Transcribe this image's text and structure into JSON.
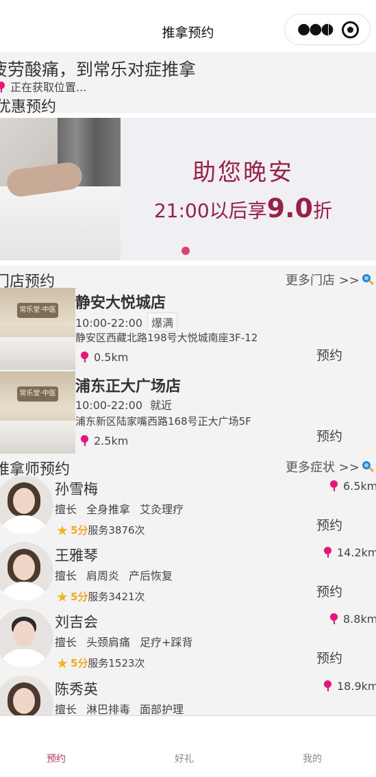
{
  "navbar": {
    "title": "推拿预约"
  },
  "header": {
    "slogan": "疲劳酸痛，到常乐对症推拿",
    "location_status": "正在获取位置..."
  },
  "sections": {
    "promo": "优惠预约",
    "stores": "门店预约",
    "therapists": "推拿师预约",
    "more_stores": "更多门店 >>",
    "more_symptoms": "更多症状 >>"
  },
  "banner": {
    "title": "助您晚安",
    "subtitle_prefix": "21:00以后享",
    "discount": "9.0",
    "subtitle_suffix": "折",
    "dot_color": "#e0436a"
  },
  "stores": [
    {
      "name": "静安大悦城店",
      "hours": "10:00-22:00",
      "status": "爆满",
      "address": "静安区西藏北路198号大悦城南座3F-12",
      "distance": "0.5km",
      "book": "预约",
      "sign": "常乐堂·中医"
    },
    {
      "name": "浦东正大广场店",
      "hours": "10:00-22:00",
      "status": "就近",
      "address": "浦东新区陆家嘴西路168号正大广场5F",
      "distance": "2.5km",
      "book": "预约",
      "sign": "常乐堂·中医"
    }
  ],
  "therapists": [
    {
      "name": "孙雪梅",
      "skills_label": "擅长",
      "skills": [
        "全身推拿",
        "艾灸理疗"
      ],
      "score": "5分",
      "served": "服务3876次",
      "distance": "6.5km",
      "book": "预约"
    },
    {
      "name": "王雅琴",
      "skills_label": "擅长",
      "skills": [
        "肩周炎",
        "产后恢复"
      ],
      "score": "5分",
      "served": "服务3421次",
      "distance": "14.2km",
      "book": "预约"
    },
    {
      "name": "刘吉会",
      "skills_label": "擅长",
      "skills": [
        "头颈肩痛",
        "足疗+踩背"
      ],
      "score": "5分",
      "served": "服务1523次",
      "distance": "8.8km",
      "book": "预约"
    },
    {
      "name": "陈秀英",
      "skills_label": "擅长",
      "skills": [
        "淋巴排毒",
        "面部护理"
      ],
      "score": "",
      "served": "",
      "distance": "18.9km",
      "book": ""
    }
  ],
  "tabbar": [
    {
      "label": "预约",
      "active": true
    },
    {
      "label": "好礼",
      "active": false
    },
    {
      "label": "我的",
      "active": false
    }
  ],
  "colors": {
    "accent": "#c23b63",
    "pin": "#e8147c",
    "star": "#f5b21a",
    "banner_text": "#9a1f45"
  }
}
